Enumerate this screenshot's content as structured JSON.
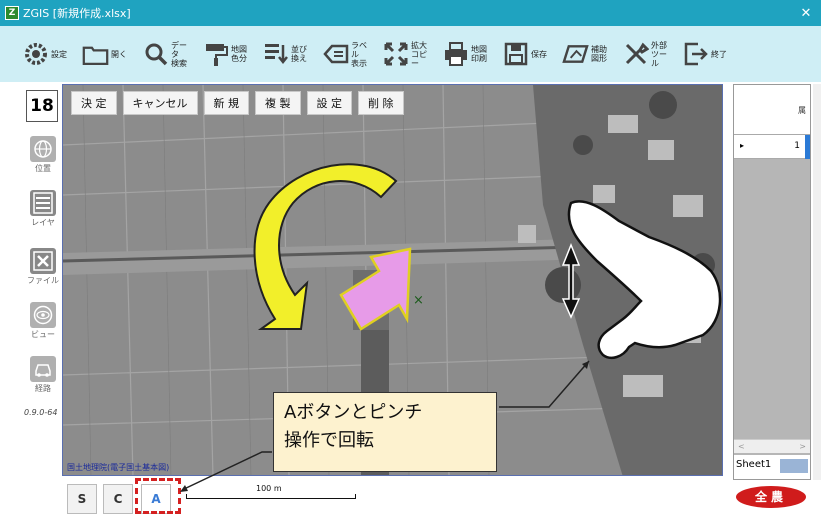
{
  "window": {
    "title": "ZGIS [新規作成.xlsx]",
    "close_glyph": "✕",
    "app_icon_letter": "Z"
  },
  "toolbar": {
    "items": [
      {
        "icon": "gear-icon",
        "label": "設定"
      },
      {
        "icon": "folder-icon",
        "label": "開く"
      },
      {
        "icon": "search-icon",
        "label": "データ\n検索"
      },
      {
        "icon": "paint-roller-icon",
        "label": "地図\n色分"
      },
      {
        "icon": "sort-icon",
        "label": "並び\n換え"
      },
      {
        "icon": "label-icon",
        "label": "ラベル\n表示"
      },
      {
        "icon": "expand-icon",
        "label": "拡大\nコピー"
      },
      {
        "icon": "printer-icon",
        "label": "地図\n印刷"
      },
      {
        "icon": "save-icon",
        "label": "保存"
      },
      {
        "icon": "shape-icon",
        "label": "補助\n図形"
      },
      {
        "icon": "tools-icon",
        "label": "外部\nツール"
      },
      {
        "icon": "exit-icon",
        "label": "終了"
      }
    ]
  },
  "left_rail": {
    "zoom_level": "18",
    "buttons": [
      {
        "icon": "globe-icon",
        "label": "位置"
      },
      {
        "icon": "layers-icon",
        "label": "レイヤ"
      },
      {
        "icon": "file-x-icon",
        "label": "ファイル"
      },
      {
        "icon": "eye-icon",
        "label": "ビュー"
      },
      {
        "icon": "car-icon",
        "label": "経路"
      }
    ],
    "version": "0.9.0-64"
  },
  "map": {
    "actions": [
      "決 定",
      "キャンセル",
      "新 規",
      "複 製",
      "設 定",
      "削 除"
    ],
    "credit": "国土地理院(電子国土基本図)",
    "center_marker": "×"
  },
  "right_panel": {
    "column_header": "属",
    "row_marker": "▸",
    "row_value": "1",
    "scroll_left": "<",
    "scroll_right": ">",
    "sheet_tab": "Sheet1"
  },
  "bottom": {
    "modes": [
      "S",
      "C",
      "A"
    ],
    "active_mode": "A",
    "scale_label": "100 m",
    "logo_text": "全農"
  },
  "callout": {
    "line1": "Aボタンとピンチ",
    "line2": "操作で回転"
  },
  "colors": {
    "titlebar": "#1fa3c0",
    "toolbar_bg": "#cfeef5",
    "highlight_red": "#d42020",
    "callout_bg": "#fdf2cf",
    "arrow_yellow": "#f2ef2a",
    "arrow_pink": "#e79be8"
  }
}
